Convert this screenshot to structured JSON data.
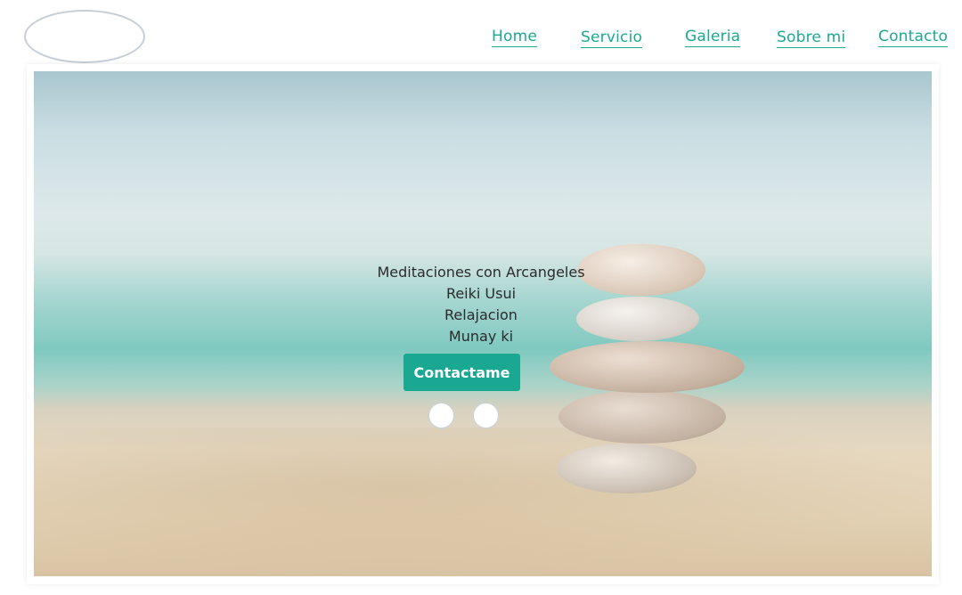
{
  "nav": {
    "items": [
      {
        "label": "Home"
      },
      {
        "label": "Servicio"
      },
      {
        "label": "Galeria"
      },
      {
        "label": "Sobre mi"
      },
      {
        "label": "Contacto"
      }
    ]
  },
  "hero": {
    "lines": [
      "Meditaciones con Arcangeles",
      "Reiki Usui",
      "Relajacion",
      "Munay ki"
    ],
    "cta_label": "Contactame",
    "slide_count": 2
  },
  "colors": {
    "accent": "#1aa893",
    "text": "#2b2b2b"
  }
}
